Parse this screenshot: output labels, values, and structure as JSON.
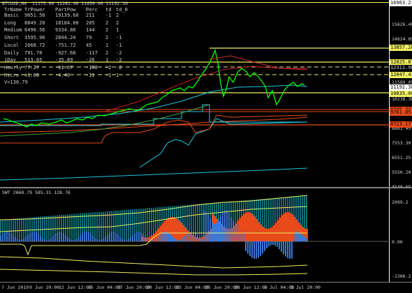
{
  "main_panel": {
    "symbol_line": "BTCUSD,H4  11175.00 11262.90 11050.00 11192.30",
    "table": {
      "headers": [
        "TrName",
        "TrPower",
        "PartPow",
        "Perc",
        "td",
        "td_0"
      ],
      "rows": [
        [
          "Basic",
          "9051.56",
          "19139.60",
          "211",
          "-1",
          "2"
        ],
        [
          "Long",
          "8849.20",
          "18184.00",
          "205",
          "2",
          "2"
        ],
        [
          "Medium",
          "6490.56",
          "9334.80",
          "144",
          "2",
          "1"
        ],
        [
          "Short",
          "3595.96",
          "2844.24",
          "79",
          "2",
          "-1"
        ],
        [
          "Local",
          "1668.72",
          "-751.72",
          "45",
          "1",
          "-1"
        ],
        [
          "Daily",
          "791.78",
          "-927.68",
          "-117",
          "2",
          "-2"
        ],
        [
          "iDay",
          "513.65",
          "-35.89",
          "-26",
          "1",
          "-2"
        ],
        [
          "Hourly",
          "77.27",
          "-81.67",
          "-108",
          "-2",
          "-2"
        ],
        [
          "Micro",
          "41.68",
          "-4.40",
          "-11",
          "-1",
          "1"
        ]
      ],
      "footer": "V=130.79"
    },
    "price_axis": [
      "16963.21",
      "15626.40",
      "14624.85",
      "11192.30",
      "11589.05",
      "10238.30",
      "8881.45",
      "7553.30",
      "6551.25",
      "5550.20",
      "4540.65"
    ],
    "price_labels": [
      {
        "text": "16963.21",
        "bg": "#ffffff",
        "fg": "#000000"
      },
      {
        "text": "13857.20",
        "bg": "#f0f060",
        "fg": "#000000"
      },
      {
        "text": "12825.87",
        "bg": "#f0f060",
        "fg": "#000000"
      },
      {
        "text": "12311.90",
        "bg": "#000000",
        "fg": "#d0d0d0"
      },
      {
        "text": "12047.43",
        "bg": "#f0f060",
        "fg": "#000000"
      },
      {
        "text": "11192.30",
        "bg": "#ffffff",
        "fg": "#000000"
      },
      {
        "text": "10835.00",
        "bg": "#f0f060",
        "fg": "#000000"
      },
      {
        "text": "9795.33",
        "bg": "#e84a1a",
        "fg": "#000000"
      },
      {
        "text": "9761.85",
        "bg": "#e84a1a",
        "fg": "#000000"
      },
      {
        "text": "8723.17",
        "bg": "#e84a1a",
        "fg": "#000000"
      }
    ]
  },
  "sub_panel": {
    "title": "SWT 2668.79 585.31 128.76",
    "axis": [
      "2999.2",
      "0.00",
      "-2306.2"
    ]
  },
  "time_axis": [
    "7 Jun 2019",
    "9 Jun 20:00",
    "12 Jun 12:00",
    "15 Jun 04:00",
    "17 Jun 20:00",
    "20 Jun 12:00",
    "23 Jun 04:00",
    "25 Jun 20:00",
    "28 Jun 12:00",
    "1 Jul 04:00",
    "3 Jul 20:00"
  ],
  "colors": {
    "background": "#000000",
    "candle_up": "#00ff00",
    "yellow": "#f0f060",
    "orange": "#e84a1a",
    "cyan": "#20c8e0",
    "blue_hist": "#3a78d8"
  }
}
